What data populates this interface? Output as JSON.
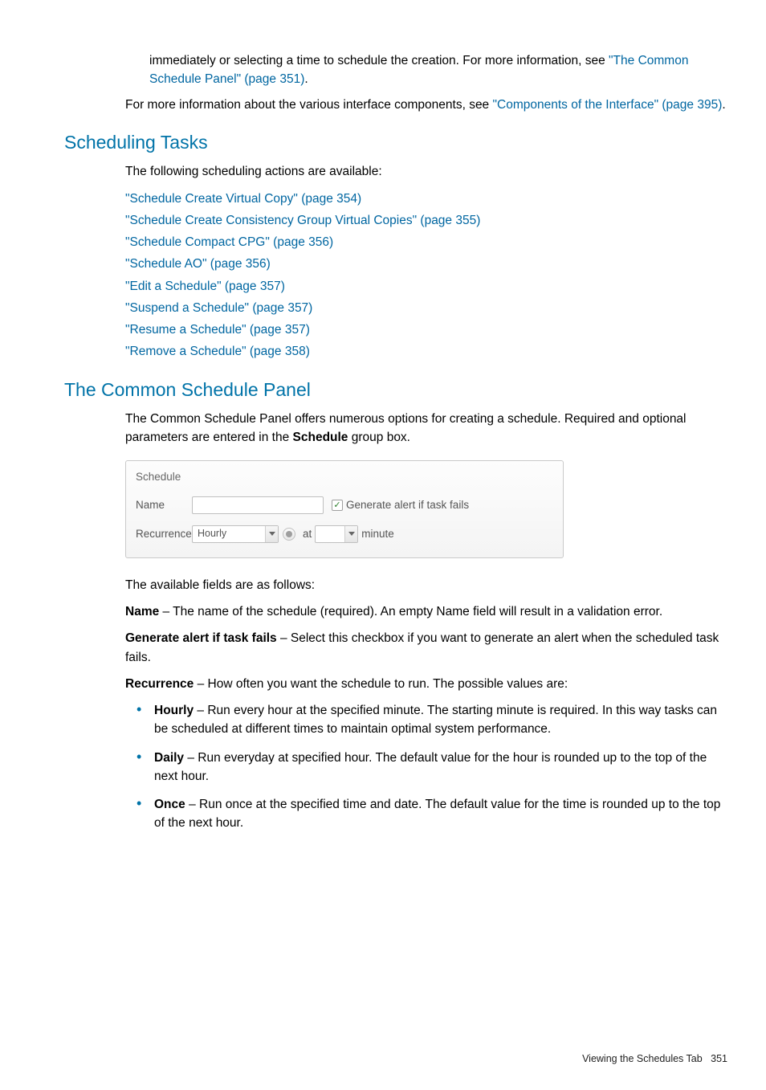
{
  "intro": {
    "line1_pre": "immediately or selecting a time to schedule the creation. For more information, see ",
    "link1": "\"The Common Schedule Panel\" (page 351)",
    "line1_post": ".",
    "line2_pre": "For more information about the various interface components, see ",
    "link2": "\"Components of the Interface\" (page 395)",
    "line2_post": "."
  },
  "heading1": "Scheduling Tasks",
  "tasks_intro": "The following scheduling actions are available:",
  "task_links": [
    "\"Schedule Create Virtual Copy\" (page 354)",
    "\"Schedule Create Consistency Group Virtual Copies\" (page 355)",
    "\"Schedule Compact CPG\" (page 356)",
    "\"Schedule AO\" (page 356)",
    "\"Edit a Schedule\" (page 357)",
    "\"Suspend a Schedule\" (page 357)",
    "\"Resume a Schedule\" (page 357)",
    "\"Remove a Schedule\" (page 358)"
  ],
  "heading2": "The Common Schedule Panel",
  "panel_intro_pre": "The Common Schedule Panel offers numerous options for creating a schedule. Required and optional parameters are entered in the ",
  "panel_intro_bold": "Schedule",
  "panel_intro_post": " group box.",
  "figure": {
    "title": "Schedule",
    "name_label": "Name",
    "name_value": "",
    "alert_checked": true,
    "alert_label": "Generate alert if task fails",
    "recurrence_label": "Recurrence",
    "recurrence_value": "Hourly",
    "at_label": "at",
    "minute_value": "",
    "minute_unit": "minute"
  },
  "fields_intro": "The available fields are as follows:",
  "field_name_label": "Name",
  "field_name_desc": " – The name of the schedule (required). An empty Name field will result in a validation error.",
  "field_alert_label": "Generate alert if task fails",
  "field_alert_desc": " – Select this checkbox if you want to generate an alert when the scheduled task fails.",
  "field_recur_label": "Recurrence",
  "field_recur_desc": " – How often you want the schedule to run. The possible values are:",
  "bullets": [
    {
      "bold": "Hourly",
      "text": " – Run every hour at the specified minute. The starting minute is required. In this way tasks can be scheduled at different times to maintain optimal system performance."
    },
    {
      "bold": "Daily",
      "text": " – Run everyday at specified hour. The default value for the hour is rounded up to the top of the next hour."
    },
    {
      "bold": "Once",
      "text": " – Run once at the specified time and date. The default value for the time is rounded up to the top of the next hour."
    }
  ],
  "footer_label": "Viewing the Schedules Tab",
  "footer_page": "351"
}
